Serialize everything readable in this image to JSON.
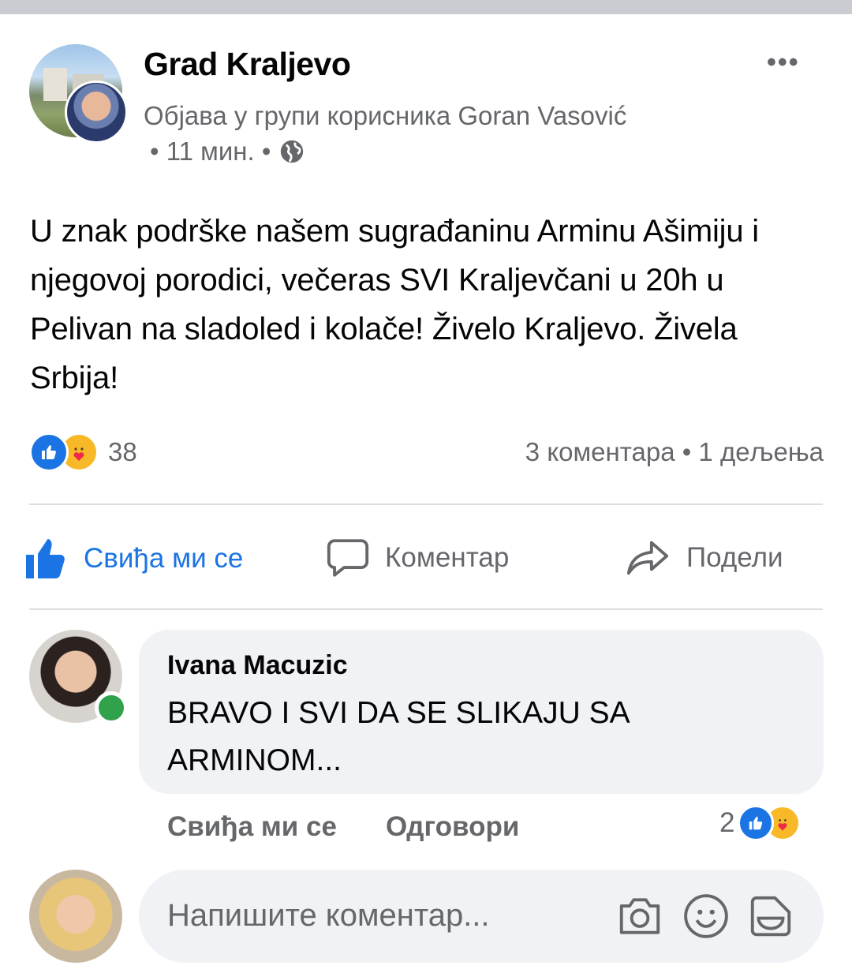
{
  "post": {
    "author": "Grad Kraljevo",
    "group_line": "Објава у групи корисника Goran Vasović",
    "time": "• 11 мин. •",
    "body": "U znak podrške našem sugrađaninu Arminu Ašimiju i njegovoj porodici, večeras SVI Kraljevčani u 20h u Pelivan na sladoled i kolače! Živelo Kraljevo. Živela Srbija!",
    "more_label": "•••",
    "reaction_count": "38",
    "stats": "3 коментара • 1 дељења"
  },
  "actions": {
    "like": "Свиђа ми се",
    "comment": "Коментар",
    "share": "Подели"
  },
  "comment": {
    "author": "Ivana Macuzic",
    "text": "BRAVO I SVI DA SE SLIKAJU SA ARMINOM...",
    "like": "Свиђа ми се",
    "reply": "Одговори",
    "reaction_count": "2"
  },
  "composer": {
    "placeholder": "Напишите коментар..."
  },
  "colors": {
    "accent": "#1b74e4",
    "muted": "#65676b",
    "online": "#31a24c"
  }
}
